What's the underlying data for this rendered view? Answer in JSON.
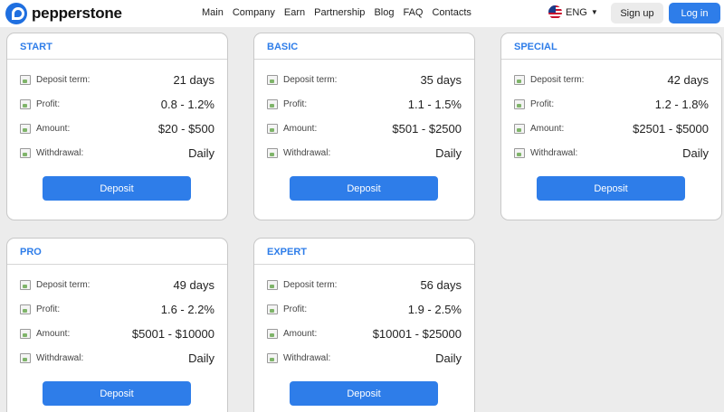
{
  "brand": {
    "name": "pepperstone",
    "accent": "#2e7de9"
  },
  "nav": {
    "items": [
      "Main",
      "Company",
      "Earn",
      "Partnership",
      "Blog",
      "FAQ",
      "Contacts"
    ]
  },
  "lang": {
    "label": "ENG"
  },
  "auth": {
    "signup_label": "Sign up",
    "login_label": "Log in"
  },
  "plans": [
    {
      "title": "START",
      "rows": [
        {
          "label": "Deposit term:",
          "value": "21 days"
        },
        {
          "label": "Profit:",
          "value": "0.8 - 1.2%"
        },
        {
          "label": "Amount:",
          "value": "$20 - $500"
        },
        {
          "label": "Withdrawal:",
          "value": "Daily"
        }
      ],
      "button": "Deposit"
    },
    {
      "title": "BASIC",
      "rows": [
        {
          "label": "Deposit term:",
          "value": "35 days"
        },
        {
          "label": "Profit:",
          "value": "1.1 - 1.5%"
        },
        {
          "label": "Amount:",
          "value": "$501 - $2500"
        },
        {
          "label": "Withdrawal:",
          "value": "Daily"
        }
      ],
      "button": "Deposit"
    },
    {
      "title": "SPECIAL",
      "rows": [
        {
          "label": "Deposit term:",
          "value": "42 days"
        },
        {
          "label": "Profit:",
          "value": "1.2 - 1.8%"
        },
        {
          "label": "Amount:",
          "value": "$2501 - $5000"
        },
        {
          "label": "Withdrawal:",
          "value": "Daily"
        }
      ],
      "button": "Deposit"
    },
    {
      "title": "PRO",
      "rows": [
        {
          "label": "Deposit term:",
          "value": "49 days"
        },
        {
          "label": "Profit:",
          "value": "1.6 - 2.2%"
        },
        {
          "label": "Amount:",
          "value": "$5001 - $10000"
        },
        {
          "label": "Withdrawal:",
          "value": "Daily"
        }
      ],
      "button": "Deposit"
    },
    {
      "title": "EXPERT",
      "rows": [
        {
          "label": "Deposit term:",
          "value": "56 days"
        },
        {
          "label": "Profit:",
          "value": "1.9 - 2.5%"
        },
        {
          "label": "Amount:",
          "value": "$10001 - $25000"
        },
        {
          "label": "Withdrawal:",
          "value": "Daily"
        }
      ],
      "button": "Deposit"
    }
  ]
}
